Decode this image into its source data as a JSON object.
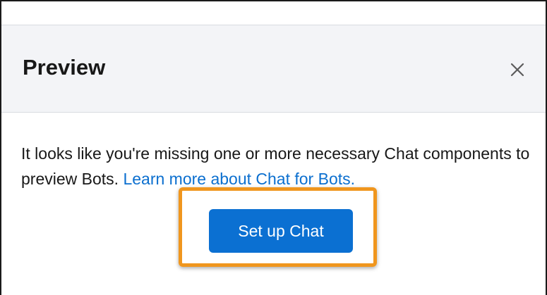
{
  "modal": {
    "title": "Preview",
    "close_icon": "close-icon",
    "message": "It looks like you're missing one or more necessary Chat components to preview Bots.",
    "link_text": "Learn more about Chat for Bots.",
    "button_label": "Set up Chat"
  },
  "colors": {
    "header_bg": "#f3f4f7",
    "link": "#0b6fcf",
    "button_bg": "#0b70d2",
    "highlight_border": "#f0961e"
  }
}
